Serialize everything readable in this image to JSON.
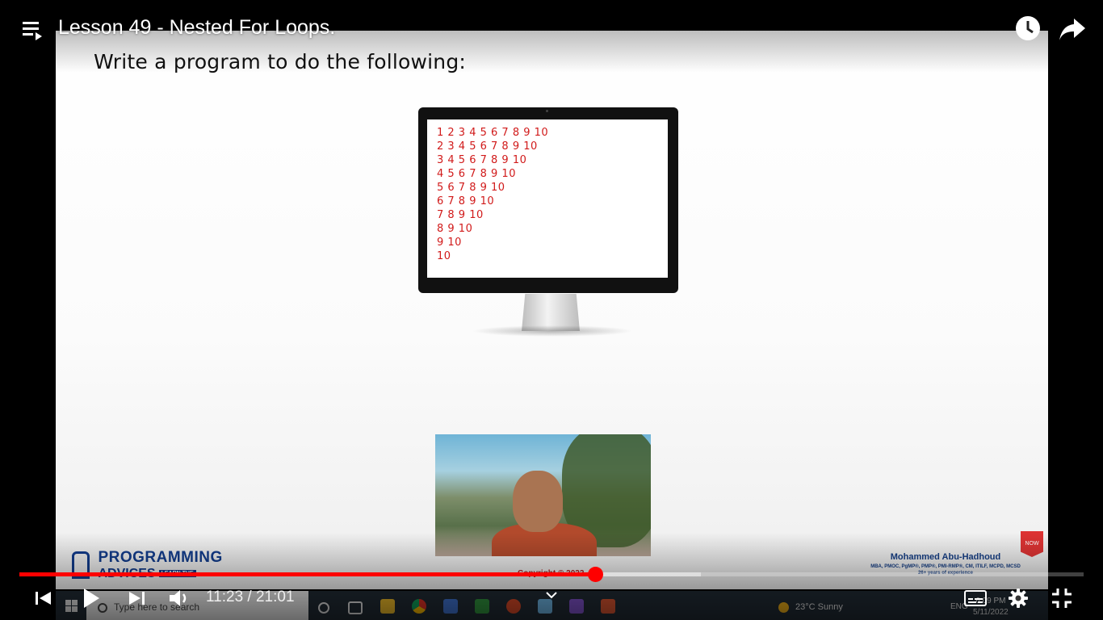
{
  "video": {
    "title": "Lesson 49 - Nested For Loops.",
    "current_time": "11:23",
    "duration": "21:01",
    "time_separator": "/",
    "progress_fraction": 0.5416,
    "buffered_fraction": 0.64
  },
  "slide": {
    "heading": "Write a program to do the following:",
    "output_lines": [
      "1 2 3 4 5 6 7 8 9 10",
      "2 3 4 5 6 7 8 9 10",
      "3 4 5 6 7 8 9 10",
      "4 5 6 7 8 9 10",
      "5 6 7 8 9 10",
      "6 7 8 9 10",
      "7 8 9 10",
      "8 9 10",
      "9 10",
      "10"
    ],
    "brand_line1": "PROGRAMMING",
    "brand_line2": "ADVICES",
    "brand_badge": "LEARN THE",
    "copyright": "Copyright © 2022",
    "author_name": "Mohammed Abu-Hadhoud",
    "author_creds": "MBA, PMOC, PgMP®, PMP®, PMI-RMP®, CM, ITILF, MCPD, MCSD",
    "author_exp": "26+ years of experience",
    "subscribe_label": "NOW"
  },
  "taskbar": {
    "search_placeholder": "Type here to search",
    "weather": "23°C  Sunny",
    "language": "ENG",
    "time": "6:09 PM",
    "date": "5/11/2022"
  },
  "icons": {
    "playlist": "playlist-icon",
    "watch_later": "clock-icon",
    "share": "share-icon",
    "prev": "skip-previous-icon",
    "play": "play-icon",
    "next": "skip-next-icon",
    "volume": "volume-icon",
    "subtitles": "subtitles-icon",
    "settings": "gear-icon",
    "exit_fullscreen": "exit-fullscreen-icon",
    "chevron": "chevron-down-icon"
  },
  "colors": {
    "accent": "#ff0000",
    "slide_output_text": "#d11a1a",
    "brand_blue": "#123c8c"
  }
}
